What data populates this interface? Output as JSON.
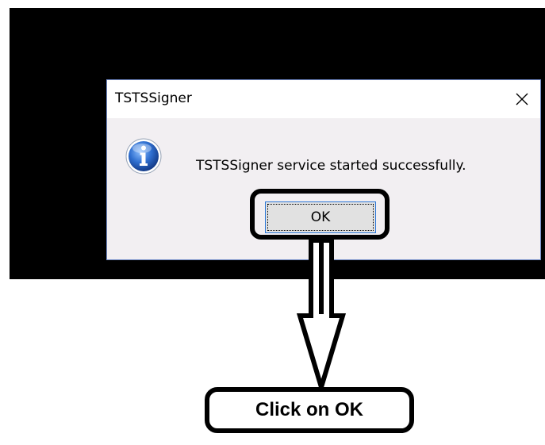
{
  "dialog": {
    "title": "TSTSSigner",
    "close_icon": "close-icon",
    "info_icon": "info-icon",
    "message": "TSTSSigner service started successfully.",
    "ok_label": "OK"
  },
  "annotation": {
    "callout_text": "Click on OK",
    "arrow_icon": "down-arrow-icon"
  },
  "colors": {
    "background_dark": "#000000",
    "dialog_body": "#f2eff2",
    "button_face": "#e1e1e1",
    "button_border": "#2a76d6",
    "info_icon_blue": "#2f6fd0"
  }
}
